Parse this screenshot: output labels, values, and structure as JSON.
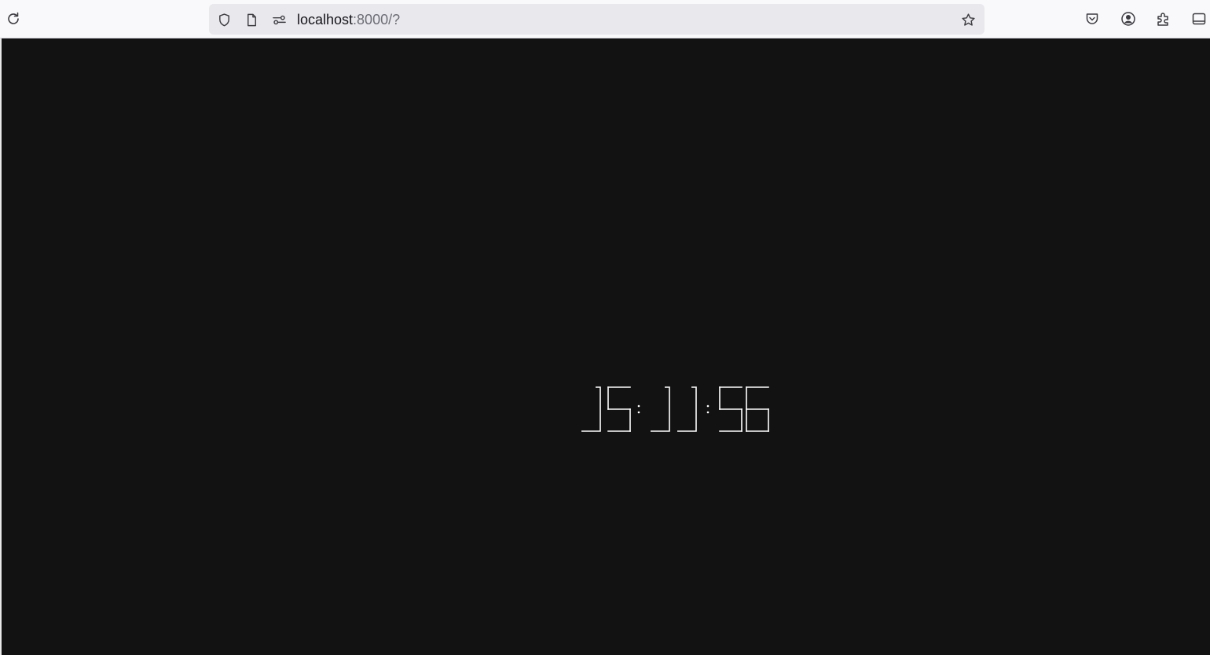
{
  "browser": {
    "url_host": "localhost",
    "url_rest": ":8000/?",
    "icons": {
      "reload": "reload-icon",
      "shield": "tracking-protection-shield-icon",
      "page": "page-info-icon",
      "permissions": "permissions-icon",
      "bookmark": "bookmark-star-icon",
      "pocket": "pocket-icon",
      "account": "account-icon",
      "extensions": "extensions-puzzle-icon",
      "sidebar": "sidebar-icon"
    }
  },
  "page": {
    "background": "#121212",
    "clock": {
      "hours": "15",
      "minutes": "11",
      "seconds": "56",
      "separator": ":",
      "color": "#ffffff"
    }
  }
}
